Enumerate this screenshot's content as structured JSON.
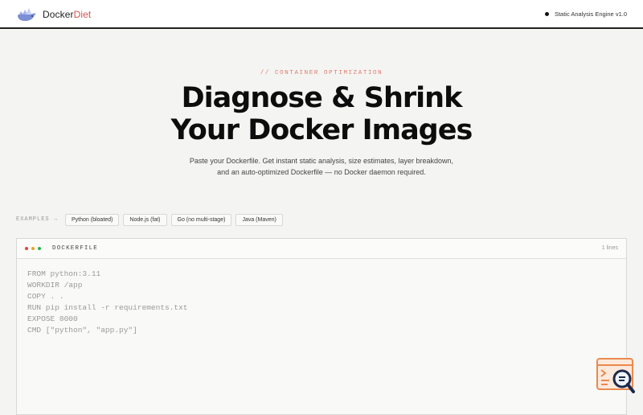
{
  "header": {
    "brand_part1": "Docker",
    "brand_part2": "Diet",
    "engine_label": "Static Analysis Engine v1.0",
    "logo_icon": "whale-icon"
  },
  "hero": {
    "kicker": "// CONTAINER OPTIMIZATION",
    "title_line1": "Diagnose & Shrink",
    "title_line2": "Your Docker Images",
    "subtitle_line1": "Paste your Dockerfile. Get instant static analysis, size estimates, layer breakdown,",
    "subtitle_line2": "and an auto-optimized Dockerfile — no Docker daemon required."
  },
  "examples": {
    "label": "EXAMPLES →",
    "items": [
      "Python (bloated)",
      "Node.js (fat)",
      "Go (no multi-stage)",
      "Java (Maven)"
    ]
  },
  "editor": {
    "title": "DOCKERFILE",
    "line_count": "1 lines",
    "placeholder_lines": [
      "FROM python:3.11",
      "WORKDIR /app",
      "COPY . .",
      "RUN pip install -r requirements.txt",
      "EXPOSE 8000",
      "CMD [\"python\", \"app.py\"]"
    ],
    "light_colors": [
      "#e0443e",
      "#e3a52b",
      "#2bb24c"
    ]
  },
  "floating": {
    "icon": "terminal-search-icon"
  },
  "colors": {
    "accent": "#d9534f",
    "background": "#f4f4f3"
  }
}
